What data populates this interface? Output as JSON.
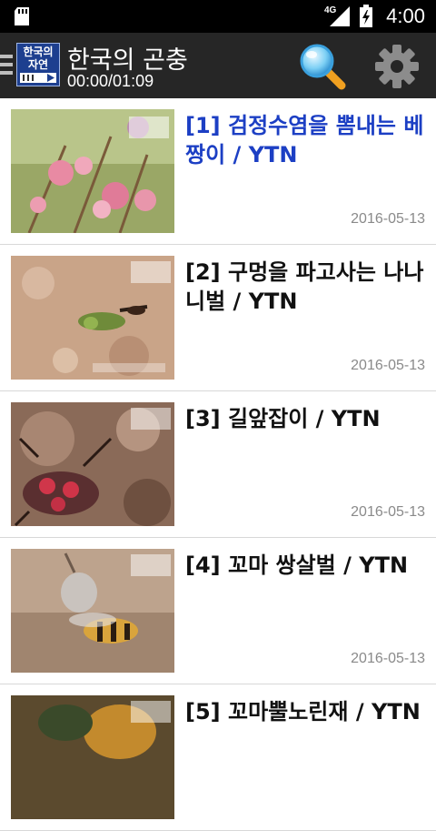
{
  "status_bar": {
    "network": "4G",
    "time": "4:00"
  },
  "action_bar": {
    "logo_line1": "한국의",
    "logo_line2": "자연",
    "title": "한국의 곤충",
    "playback_time": "00:00/01:09"
  },
  "videos": [
    {
      "title": "[1] 검정수염을 뽐내는 베짱이 / YTN",
      "date": "2016-05-13",
      "active": true
    },
    {
      "title": "[2] 구멍을 파고사는 나나니벌 / YTN",
      "date": "2016-05-13",
      "active": false
    },
    {
      "title": "[3] 길앞잡이 / YTN",
      "date": "2016-05-13",
      "active": false
    },
    {
      "title": "[4] 꼬마 쌍살벌 / YTN",
      "date": "2016-05-13",
      "active": false
    },
    {
      "title": "[5] 꼬마뿔노린재 / YTN",
      "date": "",
      "active": false
    }
  ],
  "colors": {
    "active_title": "#1c3fc4",
    "action_bar": "#262626"
  }
}
